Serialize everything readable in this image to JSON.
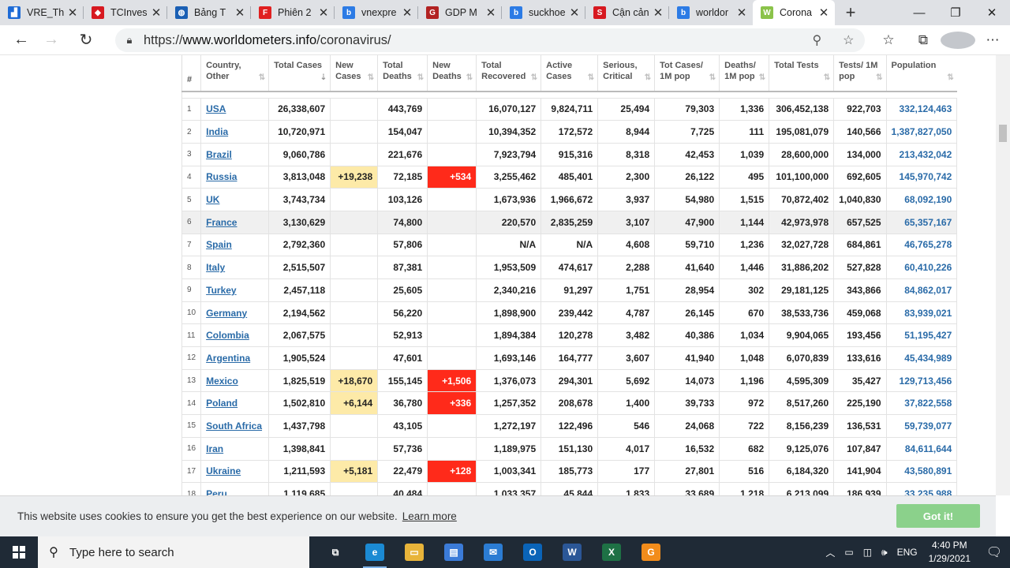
{
  "tabs": [
    {
      "title": "VRE_Th",
      "favicon_color": "#1e6bd6",
      "favicon_glyph": "chart"
    },
    {
      "title": "TCInves",
      "favicon_color": "#d71920",
      "favicon_glyph": "diamond"
    },
    {
      "title": "Bảng T",
      "favicon_color": "#1a5fb4",
      "favicon_glyph": "globe"
    },
    {
      "title": "Phiên 2",
      "favicon_color": "#e02020",
      "favicon_glyph": "F"
    },
    {
      "title": "vnexpre",
      "favicon_color": "#2c7be5",
      "favicon_glyph": "b"
    },
    {
      "title": "GDP M",
      "favicon_color": "#b22222",
      "favicon_glyph": "G"
    },
    {
      "title": "suckhoe",
      "favicon_color": "#2c7be5",
      "favicon_glyph": "b"
    },
    {
      "title": "Cận cản",
      "favicon_color": "#d71920",
      "favicon_glyph": "S"
    },
    {
      "title": "worldor",
      "favicon_color": "#2c7be5",
      "favicon_glyph": "b"
    },
    {
      "title": "Corona",
      "favicon_color": "#8bc34a",
      "favicon_glyph": "W",
      "active": true
    }
  ],
  "address": {
    "scheme": "https://",
    "host": "www.worldometers.info",
    "path": "/coronavirus/"
  },
  "table": {
    "headers": [
      "#",
      "Country, Other",
      "Total Cases",
      "New Cases",
      "Total Deaths",
      "New Deaths",
      "Total Recovered",
      "Active Cases",
      "Serious, Critical",
      "Tot Cases/ 1M pop",
      "Deaths/ 1M pop",
      "Total Tests",
      "Tests/ 1M pop",
      "Population"
    ],
    "rows": [
      {
        "i": "1",
        "country": "USA",
        "total_cases": "26,338,607",
        "new_cases": "",
        "total_deaths": "443,769",
        "new_deaths": "",
        "recovered": "16,070,127",
        "active": "9,824,711",
        "critical": "25,494",
        "cases_1m": "79,303",
        "deaths_1m": "1,336",
        "tests": "306,452,138",
        "tests_1m": "922,703",
        "population": "332,124,463"
      },
      {
        "i": "2",
        "country": "India",
        "total_cases": "10,720,971",
        "new_cases": "",
        "total_deaths": "154,047",
        "new_deaths": "",
        "recovered": "10,394,352",
        "active": "172,572",
        "critical": "8,944",
        "cases_1m": "7,725",
        "deaths_1m": "111",
        "tests": "195,081,079",
        "tests_1m": "140,566",
        "population": "1,387,827,050"
      },
      {
        "i": "3",
        "country": "Brazil",
        "total_cases": "9,060,786",
        "new_cases": "",
        "total_deaths": "221,676",
        "new_deaths": "",
        "recovered": "7,923,794",
        "active": "915,316",
        "critical": "8,318",
        "cases_1m": "42,453",
        "deaths_1m": "1,039",
        "tests": "28,600,000",
        "tests_1m": "134,000",
        "population": "213,432,042"
      },
      {
        "i": "4",
        "country": "Russia",
        "total_cases": "3,813,048",
        "new_cases": "+19,238",
        "total_deaths": "72,185",
        "new_deaths": "+534",
        "recovered": "3,255,462",
        "active": "485,401",
        "critical": "2,300",
        "cases_1m": "26,122",
        "deaths_1m": "495",
        "tests": "101,100,000",
        "tests_1m": "692,605",
        "population": "145,970,742"
      },
      {
        "i": "5",
        "country": "UK",
        "total_cases": "3,743,734",
        "new_cases": "",
        "total_deaths": "103,126",
        "new_deaths": "",
        "recovered": "1,673,936",
        "active": "1,966,672",
        "critical": "3,937",
        "cases_1m": "54,980",
        "deaths_1m": "1,515",
        "tests": "70,872,402",
        "tests_1m": "1,040,830",
        "population": "68,092,190"
      },
      {
        "i": "6",
        "country": "France",
        "total_cases": "3,130,629",
        "new_cases": "",
        "total_deaths": "74,800",
        "new_deaths": "",
        "recovered": "220,570",
        "active": "2,835,259",
        "critical": "3,107",
        "cases_1m": "47,900",
        "deaths_1m": "1,144",
        "tests": "42,973,978",
        "tests_1m": "657,525",
        "population": "65,357,167",
        "shade": true
      },
      {
        "i": "7",
        "country": "Spain",
        "total_cases": "2,792,360",
        "new_cases": "",
        "total_deaths": "57,806",
        "new_deaths": "",
        "recovered": "N/A",
        "active": "N/A",
        "critical": "4,608",
        "cases_1m": "59,710",
        "deaths_1m": "1,236",
        "tests": "32,027,728",
        "tests_1m": "684,861",
        "population": "46,765,278"
      },
      {
        "i": "8",
        "country": "Italy",
        "total_cases": "2,515,507",
        "new_cases": "",
        "total_deaths": "87,381",
        "new_deaths": "",
        "recovered": "1,953,509",
        "active": "474,617",
        "critical": "2,288",
        "cases_1m": "41,640",
        "deaths_1m": "1,446",
        "tests": "31,886,202",
        "tests_1m": "527,828",
        "population": "60,410,226"
      },
      {
        "i": "9",
        "country": "Turkey",
        "total_cases": "2,457,118",
        "new_cases": "",
        "total_deaths": "25,605",
        "new_deaths": "",
        "recovered": "2,340,216",
        "active": "91,297",
        "critical": "1,751",
        "cases_1m": "28,954",
        "deaths_1m": "302",
        "tests": "29,181,125",
        "tests_1m": "343,866",
        "population": "84,862,017"
      },
      {
        "i": "10",
        "country": "Germany",
        "total_cases": "2,194,562",
        "new_cases": "",
        "total_deaths": "56,220",
        "new_deaths": "",
        "recovered": "1,898,900",
        "active": "239,442",
        "critical": "4,787",
        "cases_1m": "26,145",
        "deaths_1m": "670",
        "tests": "38,533,736",
        "tests_1m": "459,068",
        "population": "83,939,021"
      },
      {
        "i": "11",
        "country": "Colombia",
        "total_cases": "2,067,575",
        "new_cases": "",
        "total_deaths": "52,913",
        "new_deaths": "",
        "recovered": "1,894,384",
        "active": "120,278",
        "critical": "3,482",
        "cases_1m": "40,386",
        "deaths_1m": "1,034",
        "tests": "9,904,065",
        "tests_1m": "193,456",
        "population": "51,195,427"
      },
      {
        "i": "12",
        "country": "Argentina",
        "total_cases": "1,905,524",
        "new_cases": "",
        "total_deaths": "47,601",
        "new_deaths": "",
        "recovered": "1,693,146",
        "active": "164,777",
        "critical": "3,607",
        "cases_1m": "41,940",
        "deaths_1m": "1,048",
        "tests": "6,070,839",
        "tests_1m": "133,616",
        "population": "45,434,989"
      },
      {
        "i": "13",
        "country": "Mexico",
        "total_cases": "1,825,519",
        "new_cases": "+18,670",
        "total_deaths": "155,145",
        "new_deaths": "+1,506",
        "recovered": "1,376,073",
        "active": "294,301",
        "critical": "5,692",
        "cases_1m": "14,073",
        "deaths_1m": "1,196",
        "tests": "4,595,309",
        "tests_1m": "35,427",
        "population": "129,713,456"
      },
      {
        "i": "14",
        "country": "Poland",
        "total_cases": "1,502,810",
        "new_cases": "+6,144",
        "total_deaths": "36,780",
        "new_deaths": "+336",
        "recovered": "1,257,352",
        "active": "208,678",
        "critical": "1,400",
        "cases_1m": "39,733",
        "deaths_1m": "972",
        "tests": "8,517,260",
        "tests_1m": "225,190",
        "population": "37,822,558"
      },
      {
        "i": "15",
        "country": "South Africa",
        "total_cases": "1,437,798",
        "new_cases": "",
        "total_deaths": "43,105",
        "new_deaths": "",
        "recovered": "1,272,197",
        "active": "122,496",
        "critical": "546",
        "cases_1m": "24,068",
        "deaths_1m": "722",
        "tests": "8,156,239",
        "tests_1m": "136,531",
        "population": "59,739,077"
      },
      {
        "i": "16",
        "country": "Iran",
        "total_cases": "1,398,841",
        "new_cases": "",
        "total_deaths": "57,736",
        "new_deaths": "",
        "recovered": "1,189,975",
        "active": "151,130",
        "critical": "4,017",
        "cases_1m": "16,532",
        "deaths_1m": "682",
        "tests": "9,125,076",
        "tests_1m": "107,847",
        "population": "84,611,644"
      },
      {
        "i": "17",
        "country": "Ukraine",
        "total_cases": "1,211,593",
        "new_cases": "+5,181",
        "total_deaths": "22,479",
        "new_deaths": "+128",
        "recovered": "1,003,341",
        "active": "185,773",
        "critical": "177",
        "cases_1m": "27,801",
        "deaths_1m": "516",
        "tests": "6,184,320",
        "tests_1m": "141,904",
        "population": "43,580,891"
      },
      {
        "i": "18",
        "country": "Peru",
        "total_cases": "1,119,685",
        "new_cases": "",
        "total_deaths": "40,484",
        "new_deaths": "",
        "recovered": "1,033,357",
        "active": "45,844",
        "critical": "1,833",
        "cases_1m": "33,689",
        "deaths_1m": "1,218",
        "tests": "6,213,099",
        "tests_1m": "186,939",
        "population": "33,235,988"
      }
    ]
  },
  "cookie": {
    "message": "This website uses cookies to ensure you get the best experience on our website.",
    "learn_more": "Learn more",
    "button": "Got it!"
  },
  "taskbar": {
    "search_placeholder": "Type here to search",
    "apps": [
      {
        "name": "task-view",
        "color": "#1f2a36",
        "glyph": "⧉"
      },
      {
        "name": "edge",
        "color": "#1b8ad3",
        "glyph": "e",
        "running": true
      },
      {
        "name": "file-explorer",
        "color": "#e8b43a",
        "glyph": "▭"
      },
      {
        "name": "store",
        "color": "#3b7bd8",
        "glyph": "▤"
      },
      {
        "name": "mail",
        "color": "#2b7cd3",
        "glyph": "✉"
      },
      {
        "name": "outlook",
        "color": "#0a64b8",
        "glyph": "O"
      },
      {
        "name": "word",
        "color": "#2b5797",
        "glyph": "W"
      },
      {
        "name": "excel",
        "color": "#1e7145",
        "glyph": "X"
      },
      {
        "name": "app",
        "color": "#f28c1b",
        "glyph": "G"
      }
    ],
    "lang": "ENG",
    "time": "4:40 PM",
    "date": "1/29/2021"
  }
}
